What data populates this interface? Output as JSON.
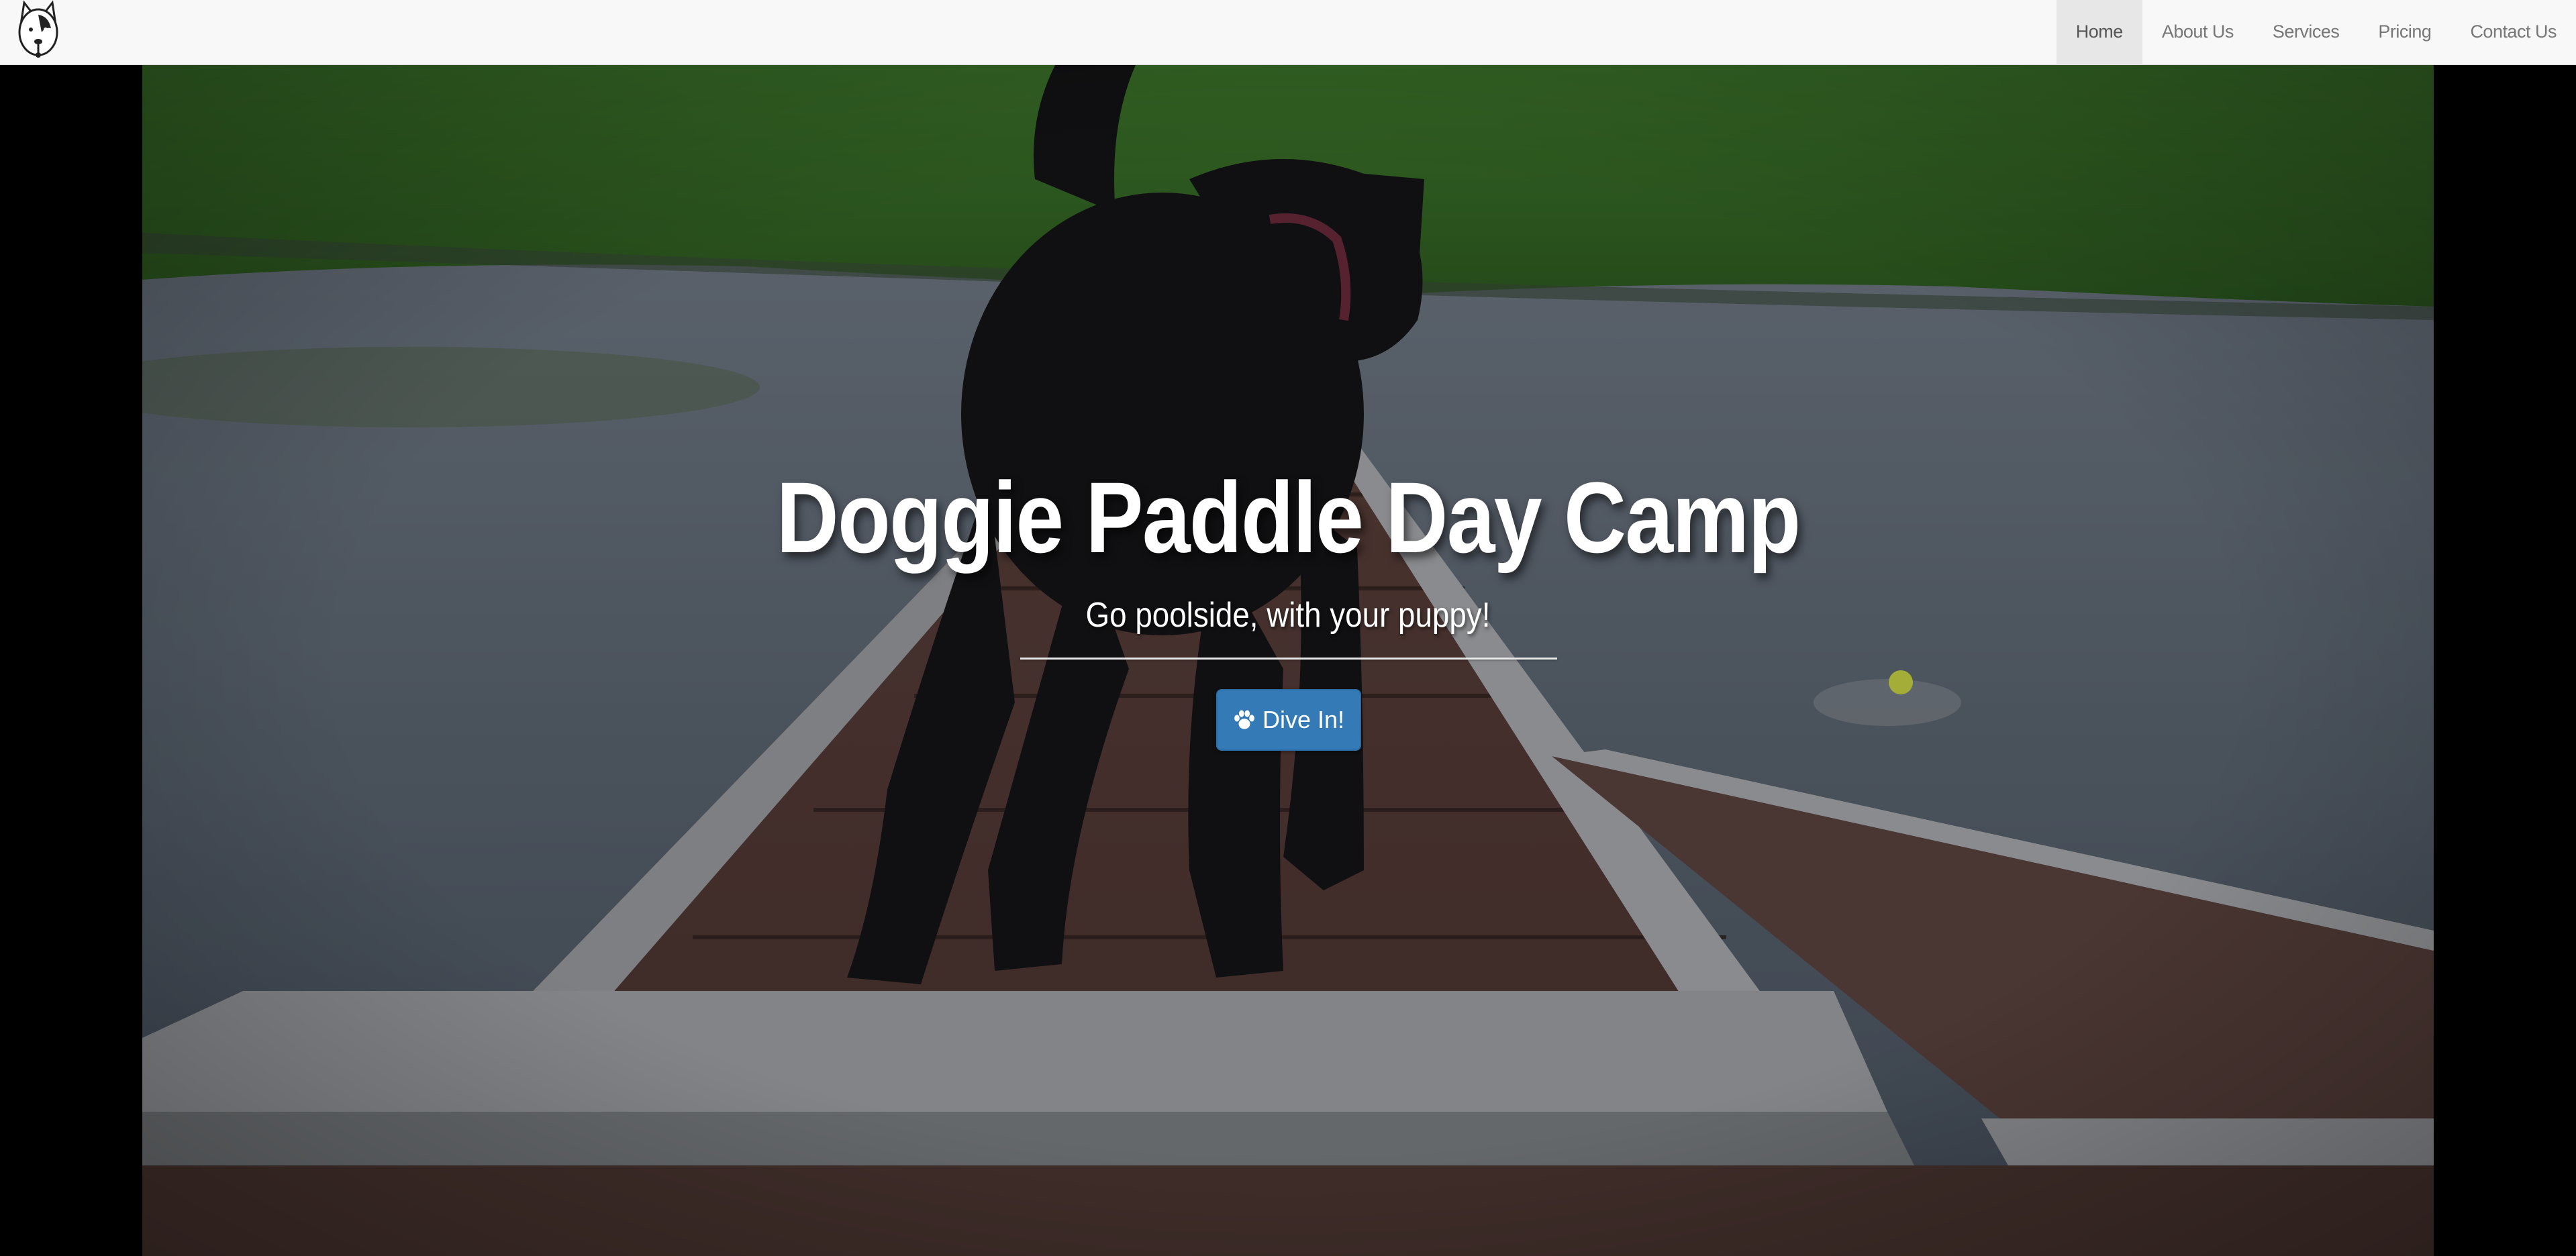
{
  "navbar": {
    "logo_icon": "husky-dog-logo",
    "items": [
      {
        "label": "Home",
        "active": true
      },
      {
        "label": "About Us",
        "active": false
      },
      {
        "label": "Services",
        "active": false
      },
      {
        "label": "Pricing",
        "active": false
      },
      {
        "label": "Contact Us",
        "active": false
      }
    ]
  },
  "hero": {
    "title": "Doggie Paddle Day Camp",
    "subtitle": "Go poolside, with your puppy!",
    "button_label": "Dive In!",
    "button_icon": "paw-icon",
    "background": "black dog on a wooden dock over a lake"
  },
  "colors": {
    "navbar_bg": "#f8f8f8",
    "active_nav_bg": "#e7e7e7",
    "button_primary": "#337ab7",
    "page_bg": "#000000"
  }
}
